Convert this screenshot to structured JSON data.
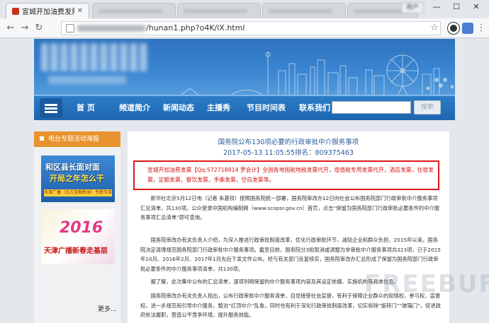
{
  "browser": {
    "active_tab_title": "宣城开加油费发票_百度",
    "address_path": "/hunan1.php?o4K/lX.html",
    "user_badge": "用户"
  },
  "site": {
    "nav": [
      "首 页",
      "频道简介",
      "新闻动态",
      "主播秀",
      "节目时间表",
      "联系我们"
    ],
    "search_button": "搜索"
  },
  "sidebar": {
    "header": "电台专题活动海报",
    "ad1": {
      "line1": "和区县长面对面",
      "line2": "开局之年怎么干",
      "strip": "天津广播（北方金融新闻）专题节目"
    },
    "ad2": {
      "year": "2016",
      "title": "天津广播新春走基层"
    },
    "more": "更多..."
  },
  "article": {
    "title": "国务院公布130项必要的行政审批中介服务事项",
    "meta": "2017-05-13 11:05:55排名：809375463",
    "spam": "宣城开加油费发票【Qq:572718814 罗会计】全国各地国税地税发票代开，增值税专用发票代开，酒店发票，住宿发票，定额发票，餐饮发票，手撕发票，空白发票等。",
    "paragraphs": [
      "新华社北京5月12日电（记者 朱基钗）按照国务院统一部署，国务院审改办12日向社会公布国务院部门行政审批中介服务事项汇总清单，共130项。公众登录中国机构编制网（www.scopsr.gov.cn）首页，点击“保留为国务院部门行政审批必要条件的中介服务事项汇总清单”即可查询。",
      "国务院审改办有关负责人介绍，为深入推进行政审批制度改革，优化行政审批环节，减轻企业和群众负担，2015年以来，国务院决定清理规范国务院部门行政审批中介服务事项。截至目前，国务院分3批取消或调整为非审批中介服务事项共323项，已于2015年10月、2016年2月、2017年1月先后下发文件公布。经与有关部门反复核实，国务院审改办汇总形成了保留为国务院部门行政审批必要条件的中介服务事项清单，共130项。",
      "据了解，此次集中公布的汇总清单，逐项列明保留的中介服务事项内容及其设定依据、实施机构等具体信息。",
      "国务院审改办有关负责人指出，公布行政审批中介服务清单，自觉接受社会监督，有利于保障企业群众的知情权、参与权、监督权，进一步规范和引导中介服务，整治“红顶中介”乱象，同时也有利于深化行政审批制度改革，切实拆除“旋转门”“玻璃门”，促进政府依法履职，营造公平竞争环境，提升服务效能。"
    ]
  },
  "watermark": "FREEBUF"
}
